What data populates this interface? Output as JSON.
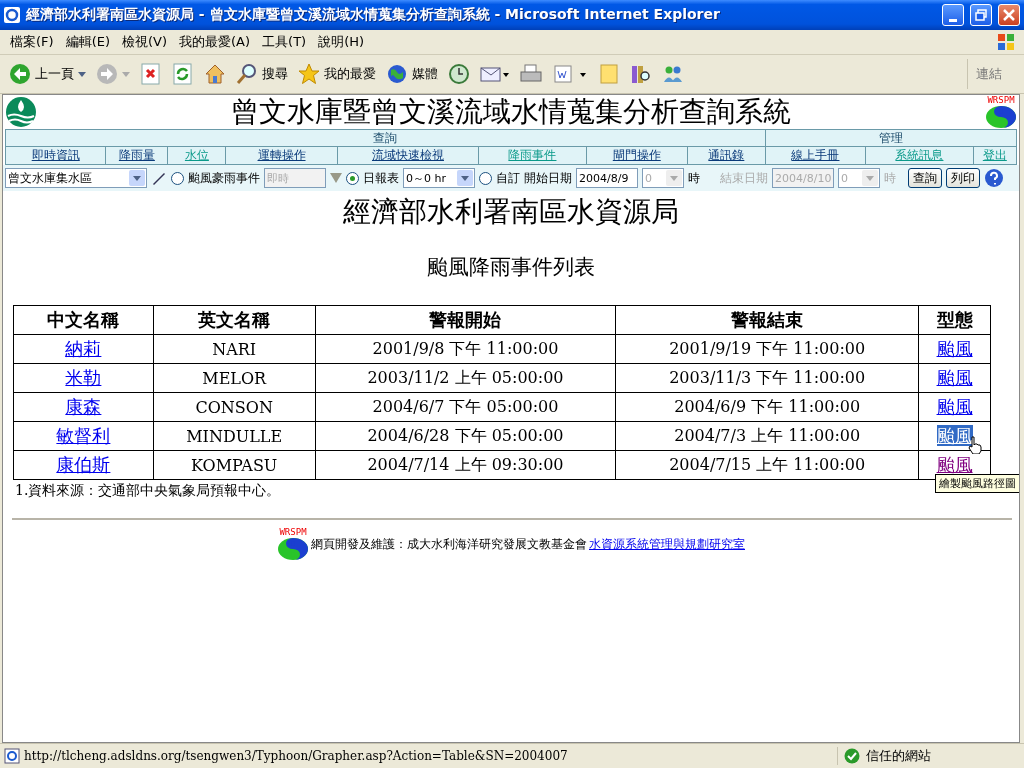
{
  "window": {
    "title": "經濟部水利署南區水資源局 - 曾文水庫暨曾文溪流域水情蒐集分析查詢系統 - Microsoft Internet Explorer"
  },
  "menu": [
    "檔案(F)",
    "編輯(E)",
    "檢視(V)",
    "我的最愛(A)",
    "工具(T)",
    "說明(H)"
  ],
  "toolbar": [
    {
      "kind": "back",
      "label": "上一頁"
    },
    {
      "kind": "forward"
    },
    {
      "kind": "stop"
    },
    {
      "kind": "refresh"
    },
    {
      "kind": "home"
    },
    {
      "kind": "search",
      "label": "搜尋"
    },
    {
      "kind": "favorites",
      "label": "我的最愛"
    },
    {
      "kind": "media",
      "label": "媒體"
    },
    {
      "kind": "history"
    },
    {
      "kind": "mail"
    },
    {
      "kind": "print"
    },
    {
      "kind": "edit"
    },
    {
      "kind": "discuss"
    },
    {
      "kind": "research"
    },
    {
      "kind": "messenger"
    }
  ],
  "links_label": "連結",
  "header": {
    "title": "曾文水庫暨曾文溪流域水情蒐集分析查詢系統",
    "badge": "WRSPM"
  },
  "nav": [
    {
      "label": "查詢",
      "links": [
        {
          "label": "即時資訊",
          "visited": false
        },
        {
          "label": "降雨量",
          "visited": false
        },
        {
          "label": "水位",
          "visited": true
        },
        {
          "label": "運轉操作",
          "visited": false
        },
        {
          "label": "流域快速檢視",
          "visited": false
        },
        {
          "label": "降雨事件",
          "visited": true
        },
        {
          "label": "閘門操作",
          "visited": false
        },
        {
          "label": "通訊錄",
          "visited": false
        }
      ]
    },
    {
      "label": "管理",
      "links": [
        {
          "label": "線上手冊",
          "visited": false
        },
        {
          "label": "系統訊息",
          "visited": true
        },
        {
          "label": "登出",
          "visited": true
        }
      ]
    }
  ],
  "filters": {
    "basin": "曾文水庫集水區",
    "event_radio": {
      "label": "颱風豪雨事件",
      "selected": false
    },
    "event_field": {
      "placeholder": "即時",
      "disabled": true
    },
    "daily_radio": {
      "label": "日報表",
      "selected": true
    },
    "range": "0～0 hr",
    "custom_radio": {
      "label": "自訂",
      "selected": false
    },
    "start": {
      "label": "開始日期",
      "date": "2004/8/9",
      "hour": "0",
      "unit": "時",
      "disabled": false,
      "hour_disabled": true
    },
    "end": {
      "label": "結束日期",
      "date": "2004/8/10",
      "hour": "0",
      "unit": "時",
      "disabled": true,
      "hour_disabled": true
    },
    "buttons": [
      "查詢",
      "列印"
    ]
  },
  "agency": "經濟部水利署南區水資源局",
  "subtitle": "颱風降雨事件列表",
  "table": {
    "columns": [
      "中文名稱",
      "英文名稱",
      "警報開始",
      "警報結束",
      "型態"
    ],
    "rows": [
      {
        "name": "納莉",
        "english": "NARI",
        "start": "2001/9/8 下午 11:00:00",
        "end": "2001/9/19 下午 11:00:00",
        "type": "颱風",
        "selected": false,
        "visited": false
      },
      {
        "name": "米勒",
        "english": "MELOR",
        "start": "2003/11/2 上午 05:00:00",
        "end": "2003/11/3 下午 11:00:00",
        "type": "颱風",
        "selected": false,
        "visited": false
      },
      {
        "name": "康森",
        "english": "CONSON",
        "start": "2004/6/7 下午 05:00:00",
        "end": "2004/6/9 下午 11:00:00",
        "type": "颱風",
        "selected": false,
        "visited": false
      },
      {
        "name": "敏督利",
        "english": "MINDULLE",
        "start": "2004/6/28 下午 05:00:00",
        "end": "2004/7/3 上午 11:00:00",
        "type": "颱風",
        "selected": true,
        "visited": false
      },
      {
        "name": "康伯斯",
        "english": "KOMPASU",
        "start": "2004/7/14 上午 09:30:00",
        "end": "2004/7/15 上午 11:00:00",
        "type": "颱風",
        "selected": false,
        "visited": true
      }
    ]
  },
  "tooltip": "繪製颱風路徑圖",
  "note": "1.資料來源：交通部中央氣象局預報中心。",
  "footer": {
    "text": "網頁開發及維護：成大水利海洋研究發展文教基金會",
    "link": "水資源系統管理與規劃研究室",
    "badge": "WRSPM"
  },
  "status": {
    "url": "http://tlcheng.adsldns.org/tsengwen3/Typhoon/Grapher.asp?Action=Table&SN=2004007",
    "zone": "信任的網站"
  }
}
